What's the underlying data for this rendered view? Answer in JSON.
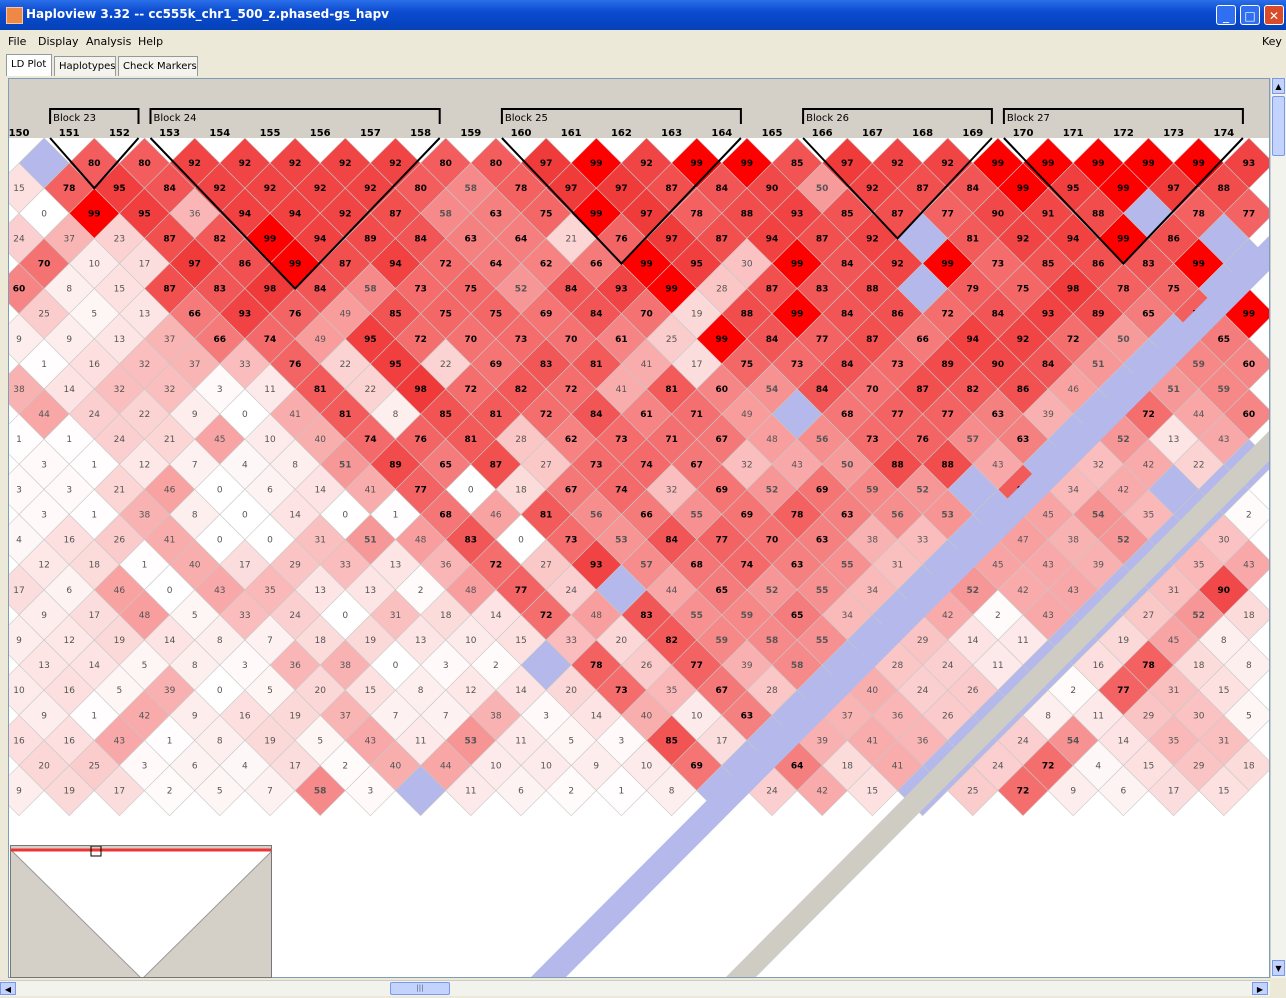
{
  "window": {
    "title": "Haploview 3.32 -- cc555k_chr1_500_z.phased-gs_hapv",
    "min_icon": "minimize-icon",
    "max_icon": "maximize-icon",
    "close_icon": "close-icon"
  },
  "menu": {
    "items": [
      "File",
      "Display",
      "Analysis",
      "Help"
    ],
    "right_label": "Key"
  },
  "tabs": [
    "LD Plot",
    "Haplotypes",
    "Check Markers"
  ],
  "markers": {
    "first": 150,
    "count": 25
  },
  "blocks": [
    {
      "label": "Block 23",
      "start": 151,
      "end": 152
    },
    {
      "label": "Block 24",
      "start": 153,
      "end": 158
    },
    {
      "label": "Block 25",
      "start": 160,
      "end": 164
    },
    {
      "label": "Block 26",
      "start": 166,
      "end": 169
    },
    {
      "label": "Block 27",
      "start": 170,
      "end": 174
    }
  ],
  "ld_rows": [
    [
      null,
      "80",
      "80",
      "92",
      "92",
      "92",
      "92",
      "92",
      "80",
      "80",
      "97",
      "99",
      "92",
      "99",
      "99",
      "85",
      "97",
      "92",
      "92",
      "99",
      "99",
      "99",
      "99",
      "99",
      "93"
    ],
    [
      "15",
      "78",
      "95",
      "84",
      "92",
      "92",
      "92",
      "92",
      "80",
      "58",
      "78",
      "97",
      "97",
      "87",
      "84",
      "90",
      "50",
      "92",
      "87",
      "84",
      "99",
      "95",
      "99",
      "97",
      "88"
    ],
    [
      "0",
      "99",
      "95",
      "36",
      "94",
      "94",
      "92",
      "87",
      "58",
      "63",
      "75",
      "99",
      "97",
      "78",
      "88",
      "93",
      "85",
      "87",
      "77",
      "90",
      "91",
      "88",
      null,
      "78",
      "77"
    ],
    [
      "24",
      "37",
      "23",
      "87",
      "82",
      "99",
      "94",
      "89",
      "84",
      "63",
      "64",
      "21",
      "76",
      "97",
      "87",
      "94",
      "87",
      "92",
      null,
      "81",
      "92",
      "94",
      "99",
      "86",
      null
    ],
    [
      "70",
      "10",
      "17",
      "97",
      "86",
      "99",
      "87",
      "94",
      "72",
      "64",
      "62",
      "66",
      "99",
      "95",
      "30",
      "99",
      "84",
      "92",
      "99",
      "73",
      "85",
      "86",
      "83",
      "99",
      null
    ],
    [
      "60",
      "8",
      "15",
      "87",
      "83",
      "98",
      "84",
      "58",
      "73",
      "75",
      "52",
      "84",
      "93",
      "99",
      "28",
      "87",
      "83",
      "88",
      null,
      "79",
      "75",
      "98",
      "78",
      "75",
      null
    ],
    [
      "25",
      "5",
      "13",
      "66",
      "93",
      "76",
      "49",
      "85",
      "75",
      "75",
      "69",
      "84",
      "70",
      "19",
      "88",
      "99",
      "84",
      "86",
      "72",
      "84",
      "93",
      "89",
      "65",
      "79",
      "99"
    ],
    [
      "9",
      "9",
      "13",
      "37",
      "66",
      "74",
      "49",
      "95",
      "72",
      "70",
      "73",
      "70",
      "61",
      "25",
      "99",
      "84",
      "77",
      "87",
      "66",
      "94",
      "92",
      "72",
      "50",
      null,
      "65"
    ],
    [
      "1",
      "16",
      "32",
      "37",
      "33",
      "76",
      "22",
      "95",
      "22",
      "69",
      "83",
      "81",
      "41",
      "17",
      "75",
      "73",
      "84",
      "73",
      "89",
      "90",
      "84",
      "51",
      null,
      "59",
      "60"
    ],
    [
      "38",
      "14",
      "32",
      "32",
      "3",
      "11",
      "81",
      "22",
      "98",
      "72",
      "82",
      "72",
      "41",
      "81",
      "60",
      "54",
      "84",
      "70",
      "87",
      "82",
      "86",
      "46",
      null,
      "51",
      "59"
    ],
    [
      "44",
      "24",
      "22",
      "9",
      "0",
      "41",
      "81",
      "8",
      "85",
      "81",
      "72",
      "84",
      "61",
      "71",
      "49",
      null,
      "68",
      "77",
      "77",
      "63",
      "39",
      null,
      "72",
      "44",
      "60"
    ],
    [
      "1",
      "1",
      "24",
      "21",
      "45",
      "10",
      "40",
      "74",
      "76",
      "81",
      "28",
      "62",
      "73",
      "71",
      "67",
      "48",
      "56",
      "73",
      "76",
      "57",
      "63",
      null,
      "52",
      "13",
      "43"
    ],
    [
      "3",
      "1",
      "12",
      "7",
      "4",
      "8",
      "51",
      "89",
      "65",
      "87",
      "27",
      "73",
      "74",
      "67",
      "32",
      "43",
      "50",
      "88",
      "88",
      "43",
      null,
      "32",
      "42",
      "22",
      null
    ],
    [
      "3",
      "3",
      "21",
      "46",
      "0",
      "6",
      "14",
      "41",
      "77",
      "0",
      "18",
      "67",
      "74",
      "32",
      "69",
      "52",
      "69",
      "59",
      "52",
      null,
      "81",
      "34",
      "42",
      null,
      null
    ],
    [
      "3",
      "1",
      "38",
      "8",
      "0",
      "14",
      "0",
      "1",
      "68",
      "46",
      "81",
      "56",
      "66",
      "55",
      "69",
      "78",
      "63",
      "56",
      "53",
      null,
      "45",
      "54",
      "35",
      null,
      "2"
    ],
    [
      "4",
      "16",
      "26",
      "41",
      "0",
      "0",
      "31",
      "51",
      "48",
      "83",
      "0",
      "73",
      "53",
      "84",
      "77",
      "70",
      "63",
      "38",
      "33",
      null,
      "47",
      "38",
      "52",
      null,
      "30"
    ],
    [
      "12",
      "18",
      "1",
      "40",
      "17",
      "29",
      "33",
      "13",
      "36",
      "72",
      "27",
      "93",
      "57",
      "68",
      "74",
      "63",
      "55",
      "31",
      null,
      "45",
      "43",
      "39",
      null,
      "35",
      "43"
    ],
    [
      "17",
      "6",
      "46",
      "0",
      "43",
      "35",
      "13",
      "13",
      "2",
      "48",
      "77",
      "24",
      null,
      "44",
      "65",
      "52",
      "55",
      "34",
      null,
      "52",
      "42",
      "43",
      null,
      "31",
      "90"
    ],
    [
      "9",
      "17",
      "48",
      "5",
      "33",
      "24",
      "0",
      "31",
      "18",
      "14",
      "72",
      "48",
      "83",
      "55",
      "59",
      "65",
      "34",
      null,
      "42",
      "2",
      "43",
      null,
      "27",
      "52",
      "18"
    ],
    [
      "9",
      "12",
      "19",
      "14",
      "8",
      "7",
      "18",
      "19",
      "13",
      "10",
      "15",
      "33",
      "20",
      "82",
      "59",
      "58",
      "55",
      null,
      "29",
      "14",
      "11",
      null,
      "19",
      "45",
      "8"
    ],
    [
      "13",
      "14",
      "5",
      "8",
      "3",
      "36",
      "38",
      "0",
      "3",
      "2",
      null,
      "78",
      "26",
      "77",
      "39",
      "58",
      null,
      "28",
      "24",
      "11",
      null,
      "16",
      "78",
      "18",
      "8"
    ],
    [
      "10",
      "16",
      "5",
      "39",
      "0",
      "5",
      "20",
      "15",
      "8",
      "12",
      "14",
      "20",
      "73",
      "35",
      "67",
      "28",
      null,
      "40",
      "24",
      "26",
      null,
      "2",
      "77",
      "31",
      "15"
    ],
    [
      "9",
      "1",
      "42",
      "9",
      "16",
      "19",
      "37",
      "7",
      "7",
      "38",
      "3",
      "14",
      "40",
      "10",
      "63",
      null,
      "37",
      "36",
      "26",
      null,
      "8",
      "11",
      "29",
      "30",
      "5"
    ],
    [
      "16",
      "16",
      "43",
      "1",
      "8",
      "19",
      "5",
      "43",
      "11",
      "53",
      "11",
      "5",
      "3",
      "85",
      "17",
      null,
      "39",
      "41",
      "36",
      null,
      "24",
      "54",
      "14",
      "35",
      "31"
    ],
    [
      "20",
      "25",
      "3",
      "6",
      "4",
      "17",
      "2",
      "40",
      "44",
      "10",
      "10",
      "9",
      "10",
      "69",
      null,
      "64",
      "18",
      "41",
      null,
      "24",
      "72",
      "4",
      "15",
      "29",
      "18"
    ],
    [
      "9",
      "19",
      "17",
      "2",
      "5",
      "7",
      "58",
      "3",
      null,
      "11",
      "6",
      "2",
      "1",
      "8",
      null,
      "24",
      "42",
      "15",
      null,
      "25",
      "72",
      "9",
      "6",
      "17",
      "15"
    ]
  ]
}
